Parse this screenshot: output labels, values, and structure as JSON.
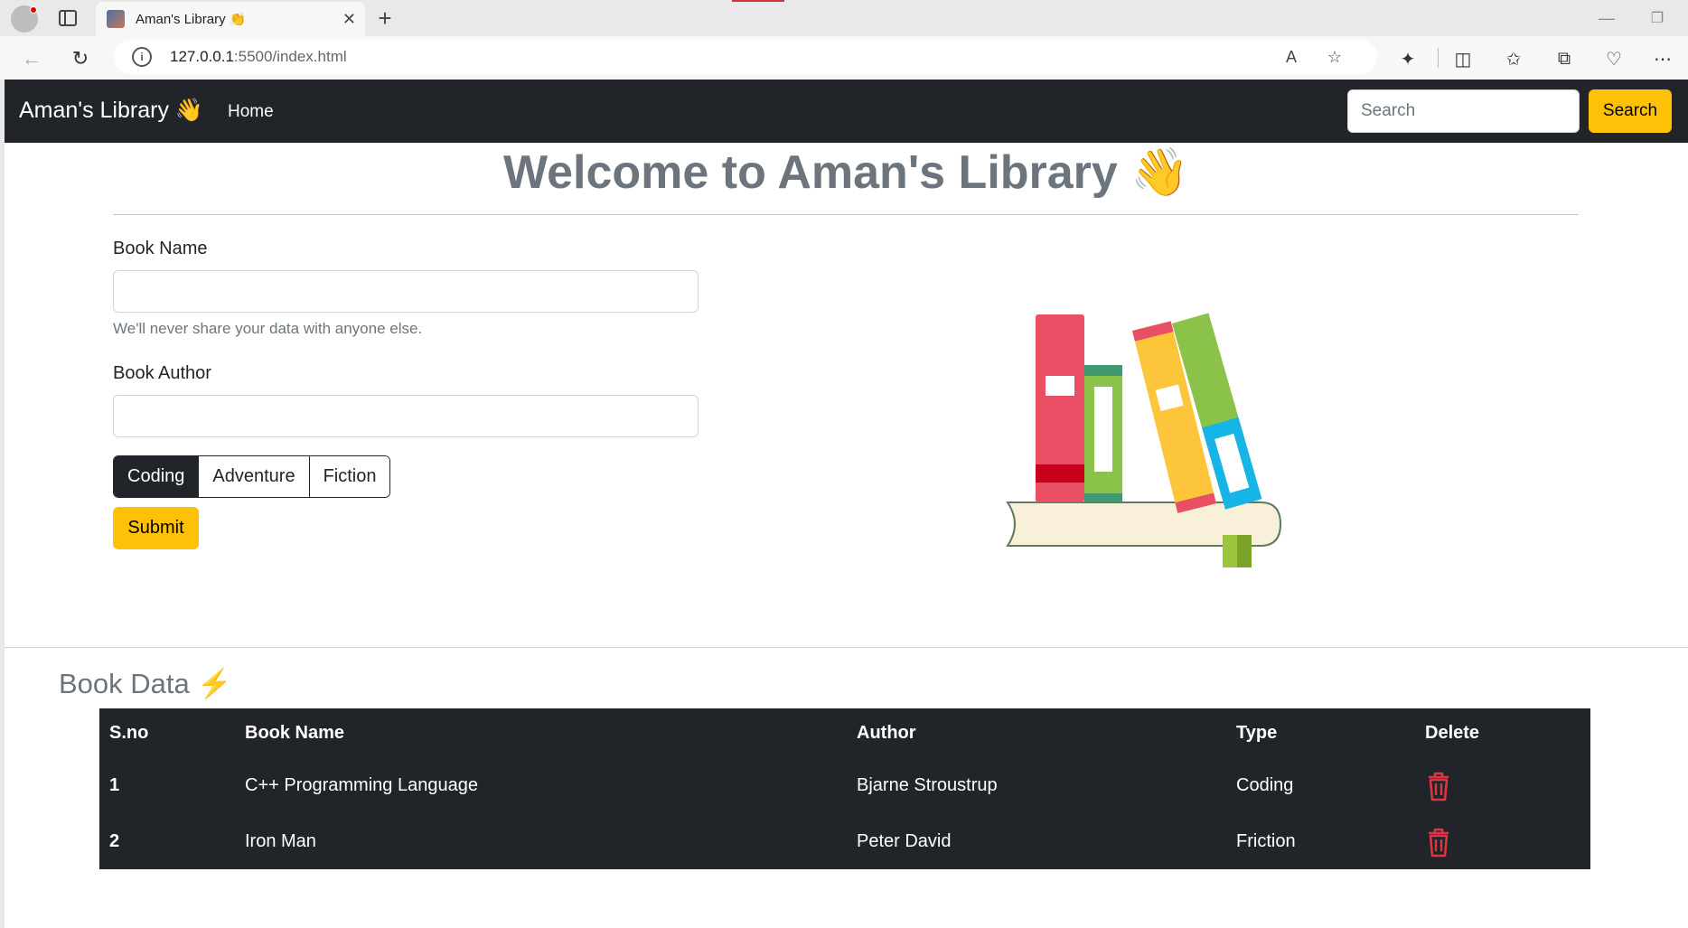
{
  "browser": {
    "tab_title": "Aman's Library 👏",
    "url_host": "127.0.0.1",
    "url_rest": ":5500/index.html"
  },
  "navbar": {
    "brand": "Aman's Library 👋",
    "home_link": "Home",
    "search_placeholder": "Search",
    "search_button": "Search"
  },
  "main": {
    "heading": "Welcome to Aman's Library 👋",
    "form": {
      "book_name_label": "Book Name",
      "book_name_value": "",
      "help_text": "We'll never share your data with anyone else.",
      "book_author_label": "Book Author",
      "book_author_value": "",
      "types": [
        "Coding",
        "Adventure",
        "Fiction"
      ],
      "selected_type": "Coding",
      "submit_label": "Submit"
    }
  },
  "book_data": {
    "heading": "Book Data ⚡",
    "columns": [
      "S.no",
      "Book Name",
      "Author",
      "Type",
      "Delete"
    ],
    "rows": [
      {
        "sno": "1",
        "name": "C++ Programming Language",
        "author": "Bjarne Stroustrup",
        "type": "Coding"
      },
      {
        "sno": "2",
        "name": "Iron Man",
        "author": "Peter David",
        "type": "Friction"
      }
    ]
  },
  "colors": {
    "navbar_bg": "#212529",
    "accent": "#ffc107",
    "delete_icon": "#dc3545"
  }
}
